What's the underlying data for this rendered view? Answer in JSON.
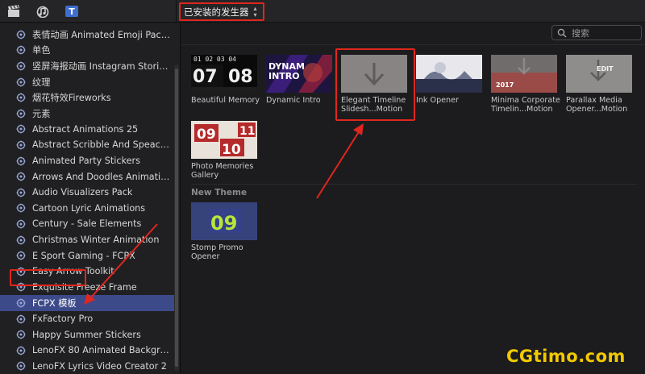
{
  "toolbar": {
    "icons": [
      "clapperboard-icon",
      "music-notes-icon",
      "titles-icon"
    ],
    "library_dropdown": "已安装的发生器"
  },
  "search": {
    "placeholder": "搜索"
  },
  "sidebar": {
    "items": [
      {
        "label": "表情动画 Animated Emoji Pack...",
        "selected": false
      },
      {
        "label": "单色",
        "selected": false
      },
      {
        "label": "竖屏海报动画 Instagram Storie...",
        "selected": false
      },
      {
        "label": "纹理",
        "selected": false
      },
      {
        "label": "烟花特效Fireworks",
        "selected": false
      },
      {
        "label": "元素",
        "selected": false
      },
      {
        "label": "Abstract Animations 25",
        "selected": false
      },
      {
        "label": "Abstract Scribble And Speach...",
        "selected": false
      },
      {
        "label": "Animated Party Stickers",
        "selected": false
      },
      {
        "label": "Arrows And Doodles Animations",
        "selected": false
      },
      {
        "label": "Audio Visualizers Pack",
        "selected": false
      },
      {
        "label": "Cartoon Lyric Animations",
        "selected": false
      },
      {
        "label": "Century - Sale Elements",
        "selected": false
      },
      {
        "label": "Christmas Winter Animation",
        "selected": false
      },
      {
        "label": "E Sport Gaming - FCPX",
        "selected": false
      },
      {
        "label": "Easy Arrow Toolkit",
        "selected": false
      },
      {
        "label": "Exquisite Freeze Frame",
        "selected": false
      },
      {
        "label": "FCPX 模板",
        "selected": true
      },
      {
        "label": "FxFactory Pro",
        "selected": false
      },
      {
        "label": "Happy Summer Stickers",
        "selected": false
      },
      {
        "label": "LenoFX 80 Animated Backgrou...",
        "selected": false
      },
      {
        "label": "LenoFX Lyrics Video Creator 2",
        "selected": false
      }
    ]
  },
  "grid": {
    "tiles": [
      {
        "caption": "Beautiful Memory",
        "thumb_text": [
          "01 02 03 04",
          "07",
          "08"
        ]
      },
      {
        "caption": "Dynamic Intro",
        "thumb_text": [
          "DYNAM",
          "INTRO"
        ]
      },
      {
        "caption": "Elegant Timeline Slidesh...Motion",
        "thumb_text": []
      },
      {
        "caption": "Ink Opener",
        "thumb_text": []
      },
      {
        "caption": "Minima Corporate Timelin...Motion",
        "thumb_text": [
          "2017"
        ]
      },
      {
        "caption": "Parallax Media Opener...Motion",
        "thumb_text": [
          "EDIT"
        ]
      },
      {
        "caption": "Photo Memories Gallery",
        "thumb_text": [
          "09",
          "11",
          "10"
        ]
      }
    ],
    "section_title": "New Theme",
    "section_tiles": [
      {
        "caption": "Stomp Promo Opener",
        "thumb_text": [
          "09"
        ]
      }
    ]
  },
  "watermark": "CGtimo.com",
  "colors": {
    "selection": "#3d4a8a",
    "highlight_box": "#e0261e",
    "watermark": "#f3c900"
  }
}
